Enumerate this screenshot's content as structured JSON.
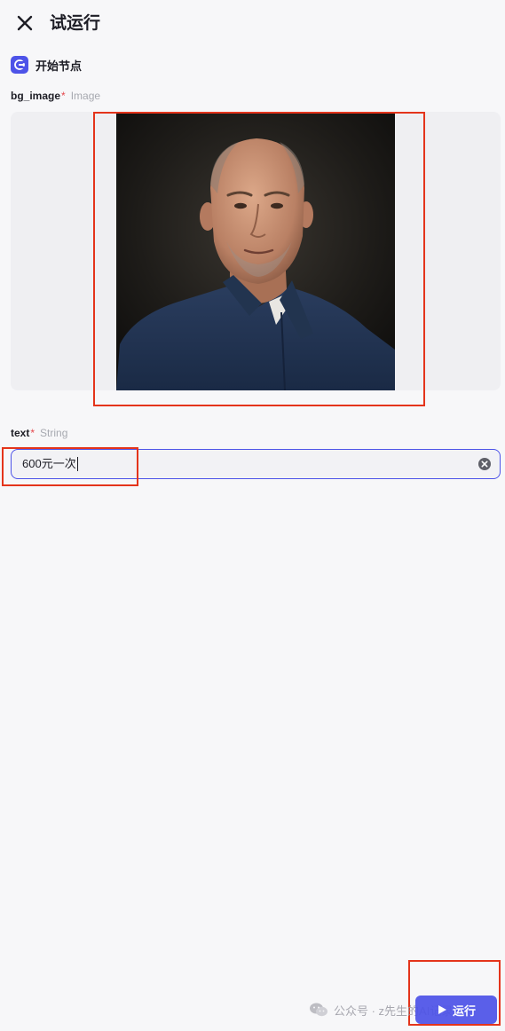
{
  "header": {
    "title": "试运行",
    "close_icon": "close-icon"
  },
  "start_node": {
    "label": "开始节点",
    "icon": "start-node-icon",
    "icon_color": "#4d53e8"
  },
  "fields": [
    {
      "name": "bg_image",
      "required_mark": "*",
      "type": "Image"
    },
    {
      "name": "text",
      "required_mark": "*",
      "type": "String",
      "value": "600元一次"
    }
  ],
  "watermark": {
    "text": "公众号 · z先生的AI记录",
    "icon": "wechat-icon"
  },
  "run_button": {
    "label": "运行",
    "icon": "play-icon"
  },
  "colors": {
    "accent": "#4d53e8",
    "annotation": "#e4341b",
    "required": "#e5484d"
  }
}
